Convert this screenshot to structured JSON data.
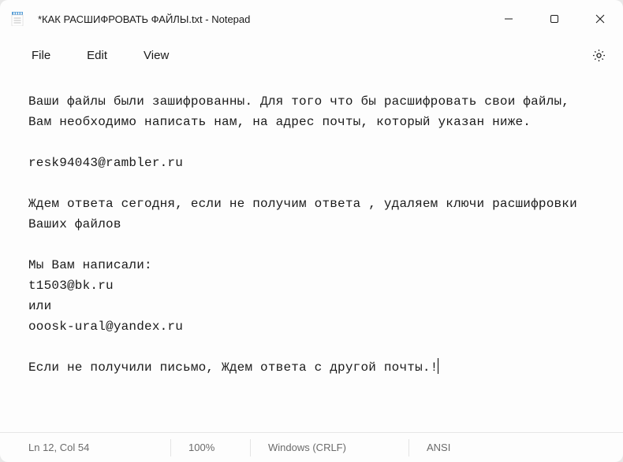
{
  "title": "*КАК РАСШИФРОВАТЬ ФАЙЛЫ.txt - Notepad",
  "menu": {
    "file": "File",
    "edit": "Edit",
    "view": "View"
  },
  "content": "Ваши файлы были зашифрованны. Для того что бы расшифровать свои файлы, Вам необходимо написать нам, на адрес почты, который указан ниже.\n\nresk94043@rambler.ru\n\nЖдем ответа сегодня, если не получим ответа , удаляем ключи расшифровки Ваших файлов\n\nМы Вам написали:\nt1503@bk.ru\nили\nooosk-ural@yandex.ru\n\nЕсли не получили письмо, Ждем ответа с другой почты.!",
  "status": {
    "position": "Ln 12, Col 54",
    "zoom": "100%",
    "line_ending": "Windows (CRLF)",
    "encoding": "ANSI"
  }
}
